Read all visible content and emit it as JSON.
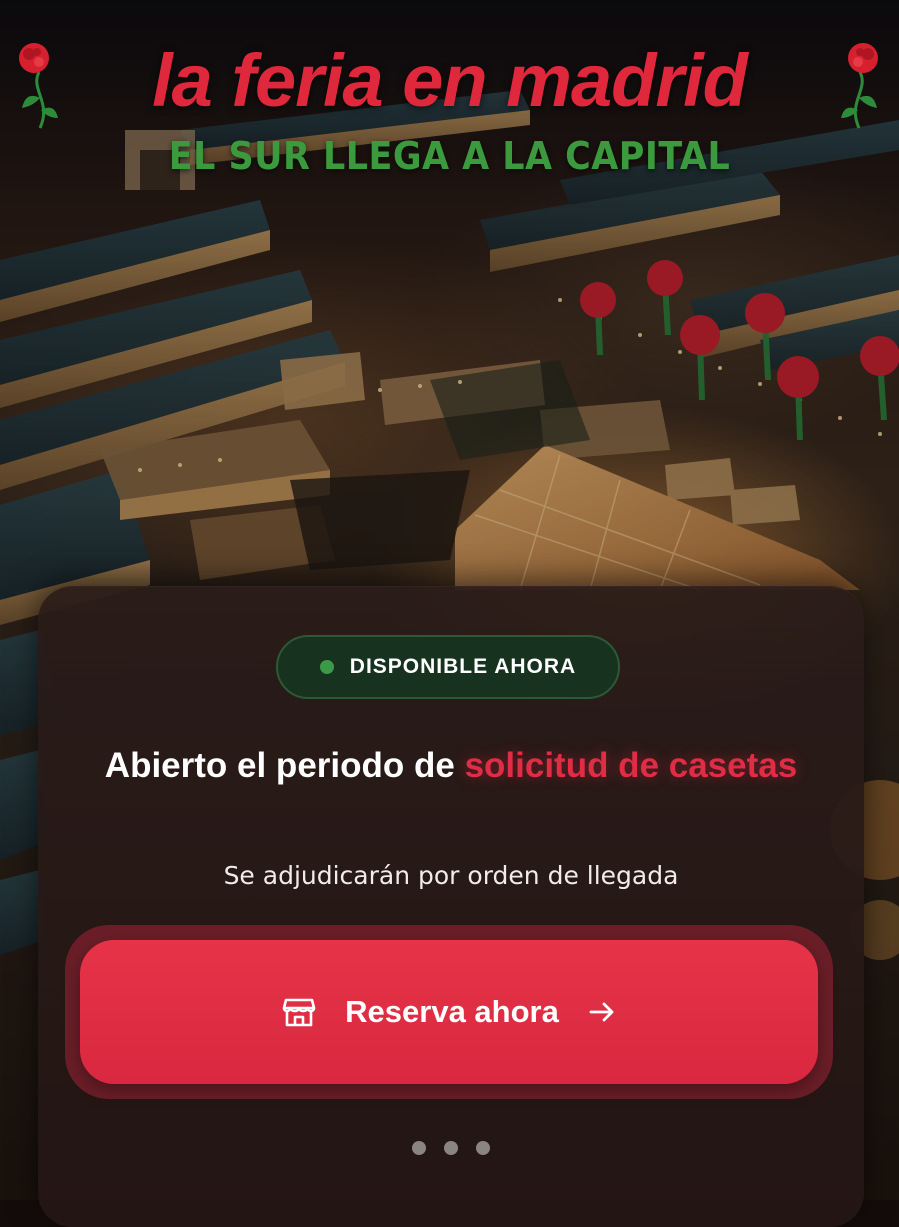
{
  "header": {
    "title": "la feria en madrid",
    "subtitle": "EL SUR LLEGA A LA CAPITAL",
    "decoration_icon": "carnation-flower"
  },
  "card": {
    "badge": {
      "label": "DISPONIBLE AHORA",
      "dot_color": "#3b9a48"
    },
    "headline": {
      "part1": "Abierto el periodo de ",
      "highlight": "solicitud de casetas"
    },
    "tagline": "Se adjudicarán por orden de llegada",
    "cta": {
      "label": "Reserva ahora",
      "icon": "store-icon",
      "trailing_icon": "arrow-right-icon"
    },
    "pagination": {
      "count": 3,
      "active_index": 0
    }
  },
  "colors": {
    "brand_red": "#e0283c",
    "brand_green": "#3c9a3e",
    "card_background": "#2a1c19",
    "badge_background": "#183220"
  }
}
